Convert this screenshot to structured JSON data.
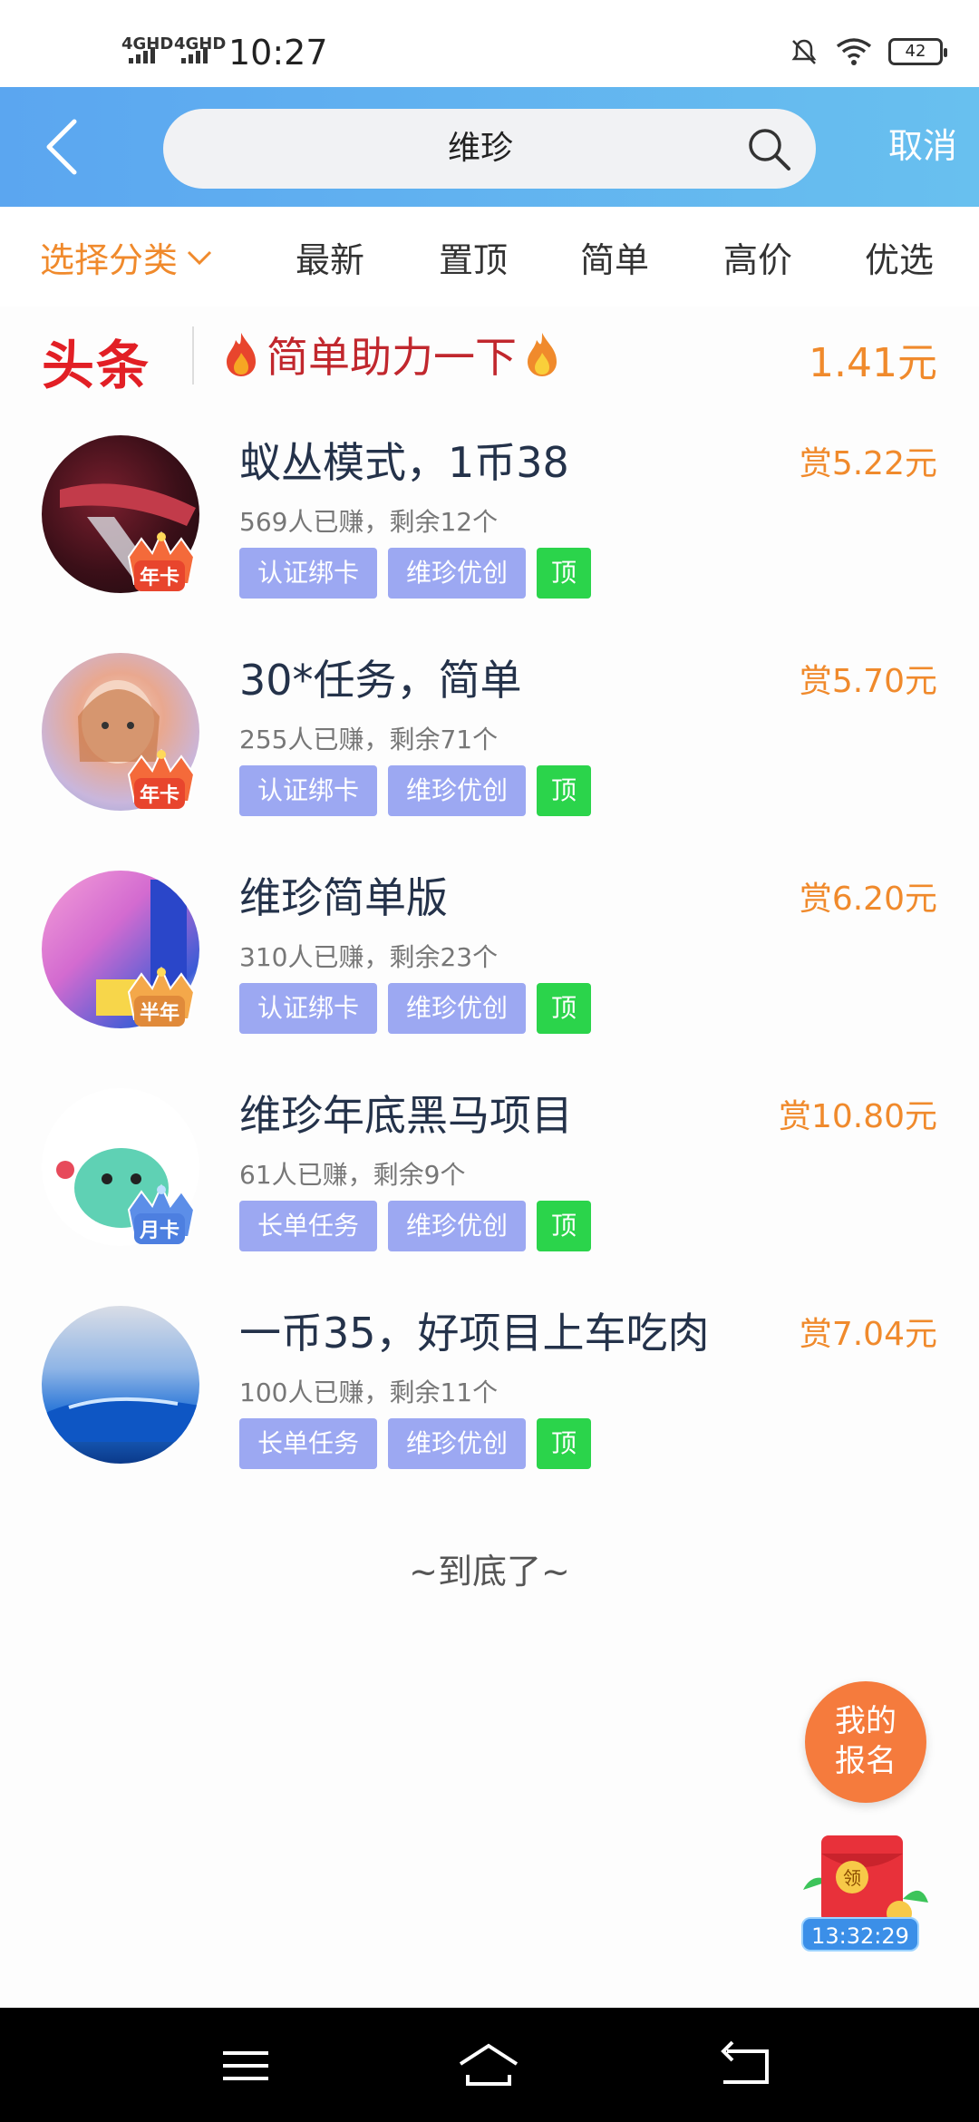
{
  "status_bar": {
    "signal1": "4GHD",
    "signal2": "4GHD",
    "time": "10:27",
    "battery": "42"
  },
  "header": {
    "search_query": "维珍",
    "cancel_label": "取消"
  },
  "filters": {
    "category_label": "选择分类",
    "tabs": [
      "最新",
      "置顶",
      "简单",
      "高价",
      "优选"
    ]
  },
  "headline": {
    "badge": "头条",
    "title": "简单助力一下",
    "price": "1.41元"
  },
  "tasks": [
    {
      "title": "蚁丛模式，1币38",
      "reward": "赏5.22元",
      "meta": "569人已赚，剩余12个",
      "tags": [
        "认证绑卡",
        "维珍优创",
        "顶"
      ],
      "crown": "年卡"
    },
    {
      "title": "30*任务，简单",
      "reward": "赏5.70元",
      "meta": "255人已赚，剩余71个",
      "tags": [
        "认证绑卡",
        "维珍优创",
        "顶"
      ],
      "crown": "年卡"
    },
    {
      "title": "维珍简单版",
      "reward": "赏6.20元",
      "meta": "310人已赚，剩余23个",
      "tags": [
        "认证绑卡",
        "维珍优创",
        "顶"
      ],
      "crown": "半年"
    },
    {
      "title": "维珍年底黑马项目",
      "reward": "赏10.80元",
      "meta": "61人已赚，剩余9个",
      "tags": [
        "长单任务",
        "维珍优创",
        "顶"
      ],
      "crown": "月卡"
    },
    {
      "title": "一币35，好项目上车吃肉",
      "reward": "赏7.04元",
      "meta": "100人已赚，剩余11个",
      "tags": [
        "长单任务",
        "维珍优创",
        "顶"
      ],
      "crown": ""
    }
  ],
  "end_text": "~到底了~",
  "floating": {
    "my_registration_line1": "我的",
    "my_registration_line2": "报名",
    "red_packet_label": "领",
    "countdown": "13:32:29"
  },
  "colors": {
    "accent_orange": "#f08a2c",
    "header_blue": "#5ba6f0",
    "tag_purple": "#9ca8f2",
    "tag_green": "#2bd44b",
    "headline_red": "#e21f25"
  }
}
